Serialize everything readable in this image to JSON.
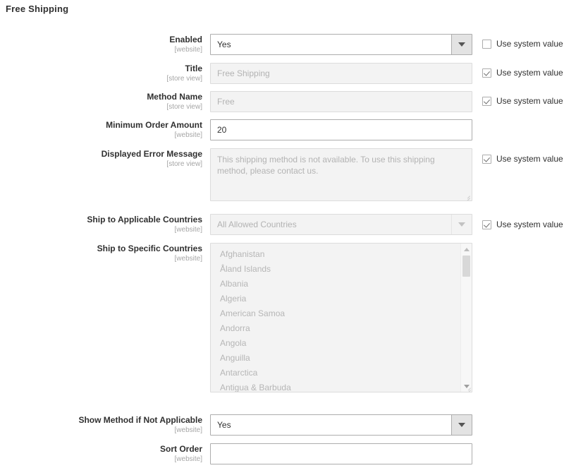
{
  "page": {
    "section_title": "Free Shipping"
  },
  "common": {
    "use_system_value": "Use system value",
    "scope_website": "[website]",
    "scope_store_view": "[store view]"
  },
  "fields": {
    "enabled": {
      "label": "Enabled",
      "scope": "[website]",
      "type": "select",
      "value": "Yes",
      "disabled": false,
      "use_system_value": false
    },
    "title": {
      "label": "Title",
      "scope": "[store view]",
      "type": "text",
      "value": "Free Shipping",
      "disabled": true,
      "use_system_value": true
    },
    "method_name": {
      "label": "Method Name",
      "scope": "[store view]",
      "type": "text",
      "value": "Free",
      "disabled": true,
      "use_system_value": true
    },
    "minimum_order_amount": {
      "label": "Minimum Order Amount",
      "scope": "[website]",
      "type": "text",
      "value": "20",
      "disabled": false,
      "use_system_value": null
    },
    "displayed_error_message": {
      "label": "Displayed Error Message",
      "scope": "[store view]",
      "type": "textarea",
      "value": "This shipping method is not available. To use this shipping method, please contact us.",
      "disabled": true,
      "use_system_value": true
    },
    "ship_to_applicable_countries": {
      "label": "Ship to Applicable Countries",
      "scope": "[website]",
      "type": "select",
      "value": "All Allowed Countries",
      "disabled": true,
      "use_system_value": true
    },
    "ship_to_specific_countries": {
      "label": "Ship to Specific Countries",
      "scope": "[website]",
      "type": "multiselect",
      "disabled": true,
      "use_system_value": null,
      "options": [
        "Afghanistan",
        "Åland Islands",
        "Albania",
        "Algeria",
        "American Samoa",
        "Andorra",
        "Angola",
        "Anguilla",
        "Antarctica",
        "Antigua & Barbuda"
      ]
    },
    "show_method_if_not_applicable": {
      "label": "Show Method if Not Applicable",
      "scope": "[website]",
      "type": "select",
      "value": "Yes",
      "disabled": false,
      "use_system_value": null
    },
    "sort_order": {
      "label": "Sort Order",
      "scope": "[website]",
      "type": "text",
      "value": "",
      "disabled": false,
      "use_system_value": null
    }
  },
  "colors": {
    "text": "#303030",
    "muted": "#a6a6a6",
    "placeholder": "#b3b3b3",
    "border": "#adadad",
    "disabled_bg": "#f3f3f3",
    "disabled_border": "#dcdcdc"
  }
}
